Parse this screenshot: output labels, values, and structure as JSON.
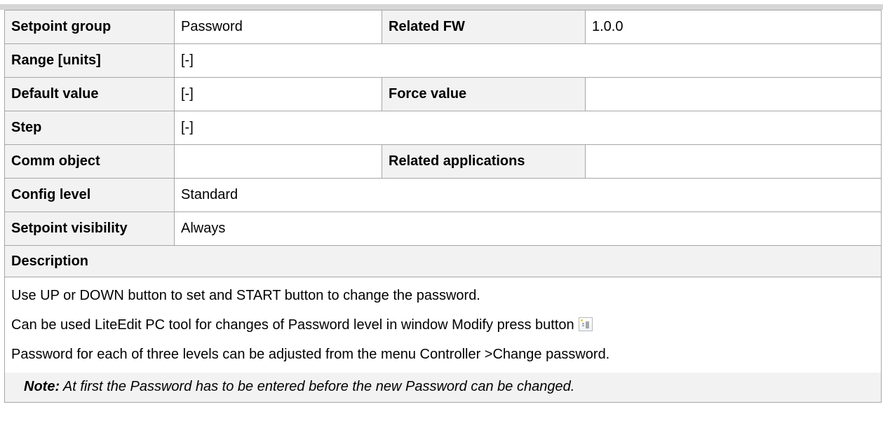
{
  "rows": {
    "setpoint_group": {
      "label": "Setpoint group",
      "value": "Password"
    },
    "related_fw": {
      "label": "Related FW",
      "value": "1.0.0"
    },
    "range": {
      "label": "Range [units]",
      "value": "[-]"
    },
    "default_value": {
      "label": "Default value",
      "value": "[-]"
    },
    "force_value": {
      "label": "Force value",
      "value": ""
    },
    "step": {
      "label": "Step",
      "value": "[-]"
    },
    "comm_object": {
      "label": "Comm object",
      "value": ""
    },
    "related_applications": {
      "label": "Related applications",
      "value": ""
    },
    "config_level": {
      "label": "Config level",
      "value": "Standard"
    },
    "setpoint_visibility": {
      "label": "Setpoint visibility",
      "value": "Always"
    }
  },
  "description": {
    "heading": "Description",
    "paragraphs": [
      "Use UP or DOWN button to set and START button to change the password.",
      "Can be used LiteEdit PC tool for changes of Password level in window Modify press button",
      "Password for each of three levels can be adjusted from the menu Controller >Change password."
    ],
    "icon": "modify-button-icon",
    "note_label": "Note:",
    "note_text": " At first the Password has to be entered before the new Password can be changed."
  },
  "colors": {
    "label_bg": "#f2f2f2",
    "border": "#a6a6a6",
    "heading_red": "#c0282d"
  }
}
